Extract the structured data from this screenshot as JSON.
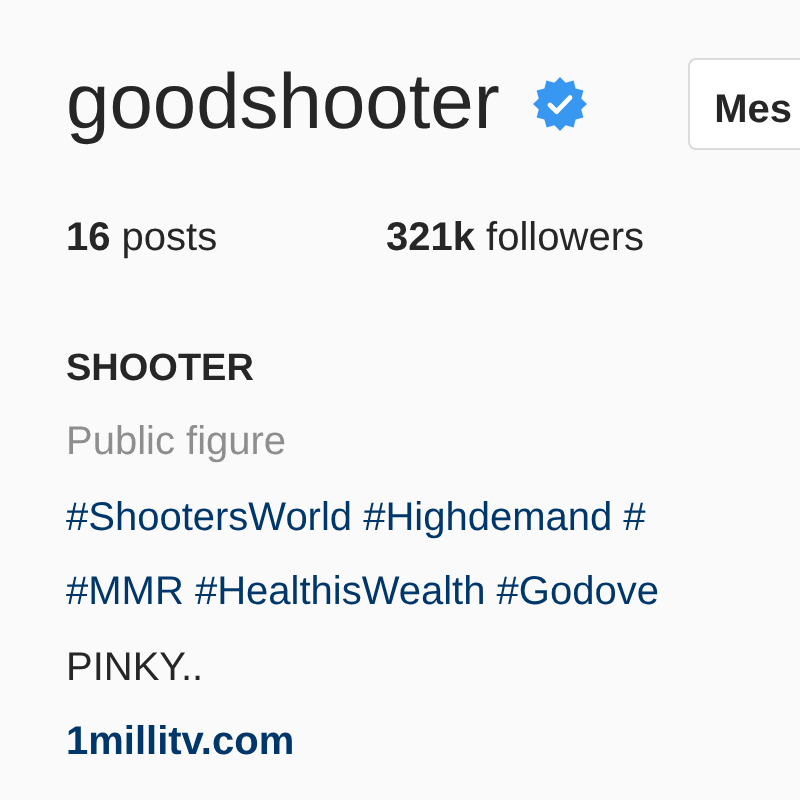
{
  "profile": {
    "username": "goodshooter",
    "verified": true,
    "message_button": "Mes",
    "stats": [
      {
        "count": "16",
        "label": "posts"
      },
      {
        "count": "321k",
        "label": "followers"
      }
    ],
    "full_name": "SHOOTER",
    "category": "Public figure",
    "bio_lines": [
      "#ShootersWorld #Highdemand #",
      "#MMR #HealthisWealth #Godove",
      "PINKY.."
    ],
    "website": "1millitv.com"
  }
}
